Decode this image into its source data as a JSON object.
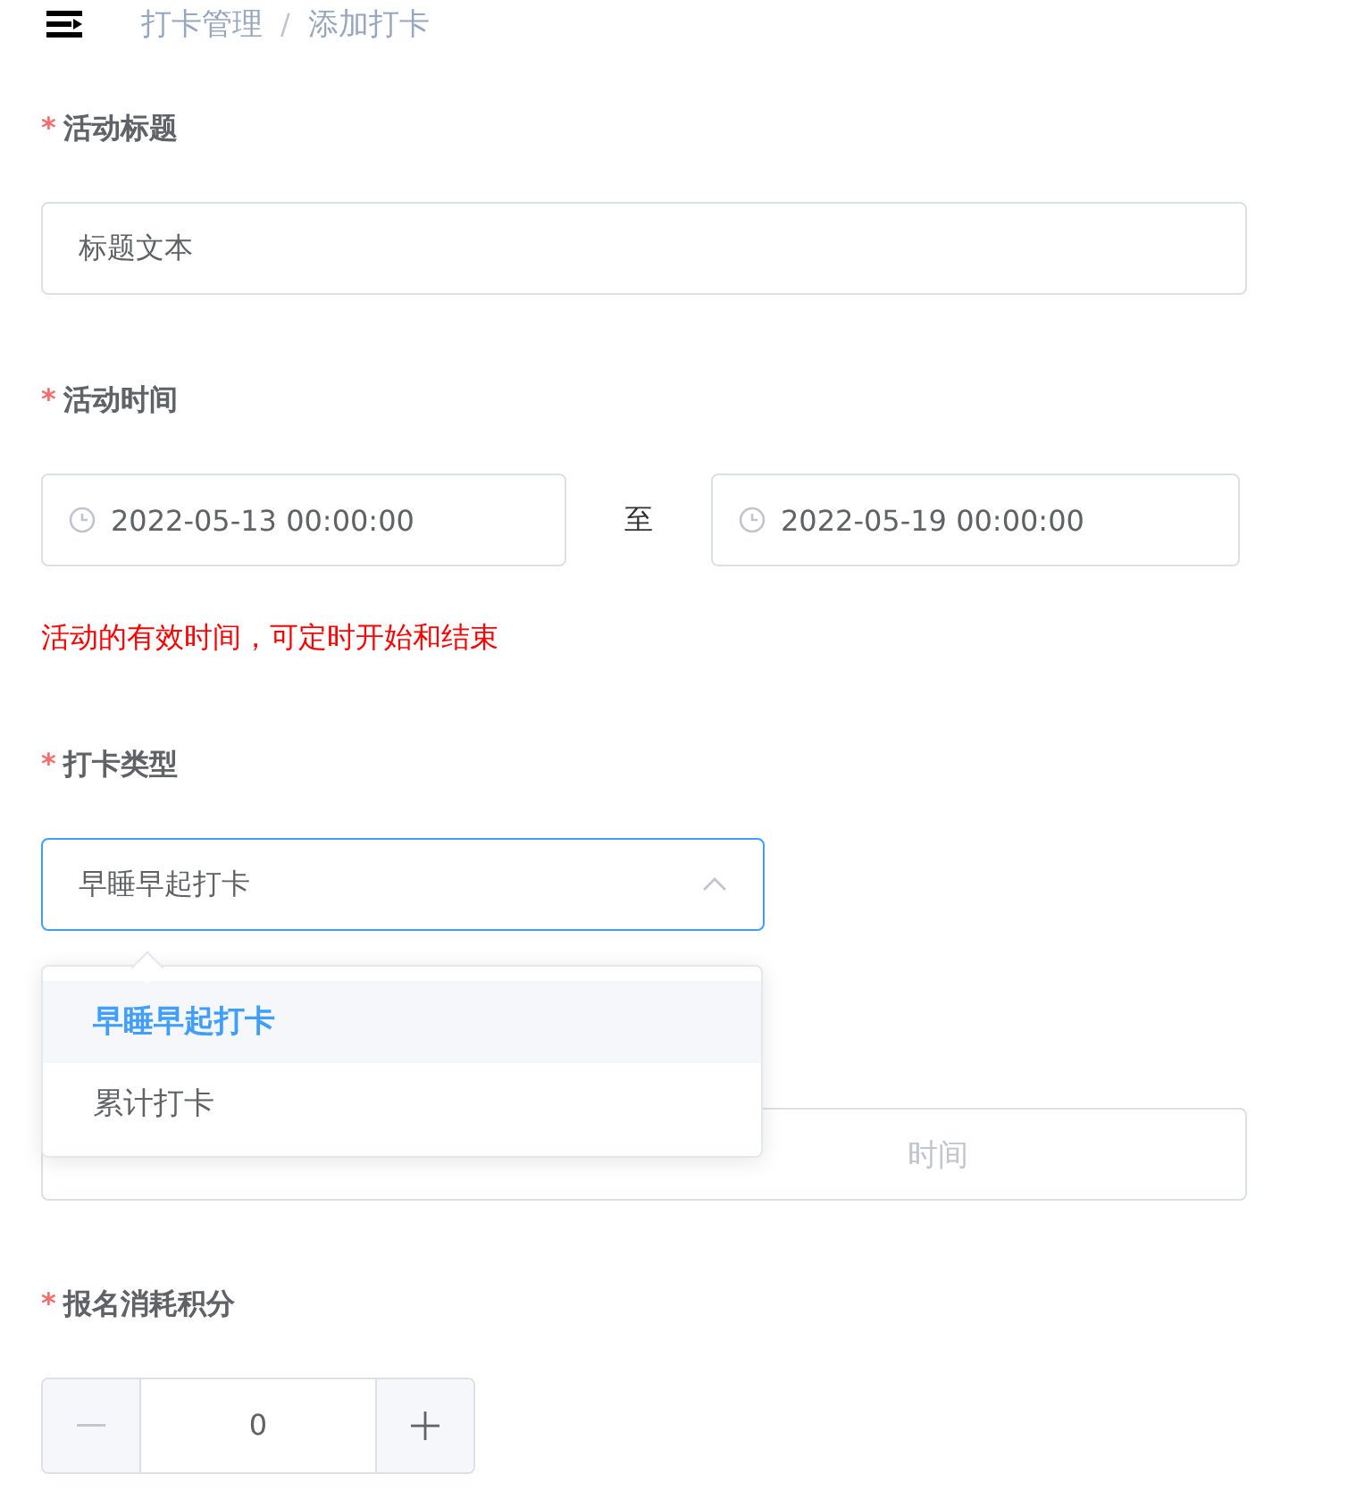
{
  "breadcrumb": [
    "打卡管理",
    "添加打卡"
  ],
  "breadcrumb_separator": "/",
  "required_mark": "*",
  "title_field": {
    "label": "活动标题",
    "required": true,
    "value": "标题文本"
  },
  "time_field": {
    "label": "活动时间",
    "required": true,
    "start": "2022-05-13 00:00:00",
    "separator": "至",
    "end": "2022-05-19 00:00:00",
    "hint": "活动的有效时间，可定时开始和结束"
  },
  "type_field": {
    "label": "打卡类型",
    "required": true,
    "value": "早睡早起打卡",
    "expanded": true,
    "options": [
      {
        "label": "早睡早起打卡",
        "selected": true
      },
      {
        "label": "累计打卡",
        "selected": false
      }
    ]
  },
  "signup_time_field": {
    "end_placeholder": "时间"
  },
  "points_field": {
    "label": "报名消耗积分",
    "required": true,
    "value": "0"
  }
}
